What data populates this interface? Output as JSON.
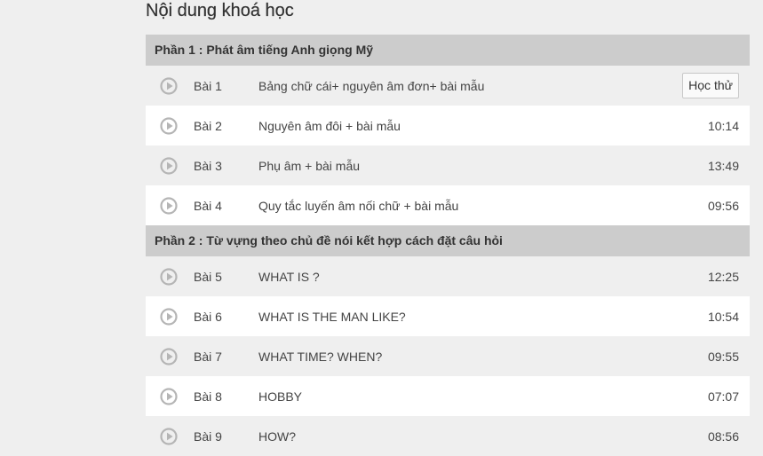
{
  "page": {
    "title": "Nội dung khoá học"
  },
  "sections": [
    {
      "label": "Phần 1 : Phát âm tiếng Anh giọng Mỹ",
      "lessons": [
        {
          "num": "Bài 1",
          "name": "Bảng chữ cái+ nguyên âm đơn+ bài mẫu",
          "action": "Học thử"
        },
        {
          "num": "Bài 2",
          "name": "Nguyên âm đôi + bài mẫu",
          "duration": "10:14"
        },
        {
          "num": "Bài 3",
          "name": "Phụ âm + bài mẫu",
          "duration": "13:49"
        },
        {
          "num": "Bài 4",
          "name": "Quy tắc luyến âm nối chữ + bài mẫu",
          "duration": "09:56"
        }
      ]
    },
    {
      "label": "Phần 2 : Từ vựng theo chủ đề nói kết hợp cách đặt câu hỏi",
      "lessons": [
        {
          "num": "Bài 5",
          "name": "WHAT IS ?",
          "duration": "12:25"
        },
        {
          "num": "Bài 6",
          "name": "WHAT IS THE MAN LIKE?",
          "duration": "10:54"
        },
        {
          "num": "Bài 7",
          "name": "WHAT TIME? WHEN?",
          "duration": "09:55"
        },
        {
          "num": "Bài 8",
          "name": "HOBBY",
          "duration": "07:07"
        },
        {
          "num": "Bài 9",
          "name": "HOW?",
          "duration": "08:56"
        }
      ]
    }
  ],
  "icons": {
    "play": "play-circle-icon"
  },
  "colors": {
    "section_bg": "#cccccc",
    "row_alt_bg": "#ffffff",
    "row_bg": "#efefef",
    "play_icon": "#b5b5b5"
  }
}
